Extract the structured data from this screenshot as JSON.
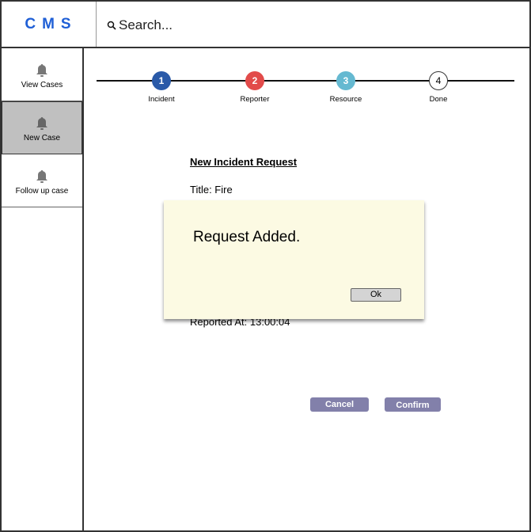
{
  "header": {
    "logo": "CMS",
    "search_placeholder": "Search..."
  },
  "sidebar": {
    "items": [
      {
        "label": "View Cases",
        "icon": "bell-icon"
      },
      {
        "label": "New Case",
        "icon": "bell-icon",
        "active": true
      },
      {
        "label": "Follow up case",
        "icon": "bell-icon"
      }
    ]
  },
  "steps": [
    {
      "number": "1",
      "label": "Incident",
      "color": "#2a5aa8"
    },
    {
      "number": "2",
      "label": "Reporter",
      "color": "#e24b4a"
    },
    {
      "number": "3",
      "label": "Resource",
      "color": "#65b9d1"
    },
    {
      "number": "4",
      "label": "Done",
      "color": "#ffffff"
    }
  ],
  "form": {
    "title": "New Incident Request",
    "title_line": "Title: Fire",
    "reported_at": "Reported At: 13:00:04"
  },
  "dialog": {
    "message": "Request Added.",
    "ok_label": "Ok"
  },
  "actions": {
    "cancel_label": "Cancel",
    "confirm_label": "Confirm"
  }
}
